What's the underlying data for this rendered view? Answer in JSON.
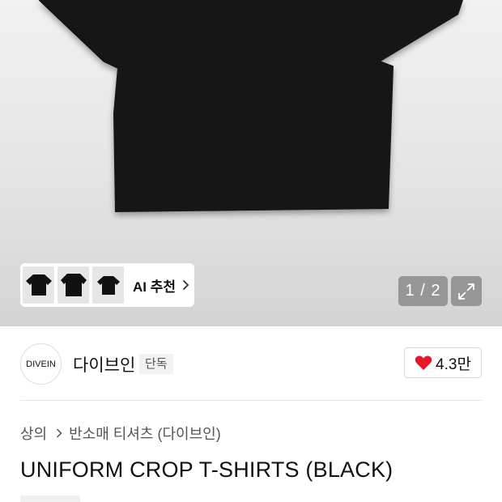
{
  "gallery": {
    "ai_recommend_label": "AI 추천",
    "page_indicator": "1 / 2",
    "thumbnail_count": 3
  },
  "brand": {
    "logo_text": "DIVEIN",
    "name": "다이브인",
    "badge": "단독",
    "like_count": "4.3만"
  },
  "breadcrumb": {
    "items": [
      "상의",
      "반소매 티셔츠 (다이브인)"
    ]
  },
  "product": {
    "title": "UNIFORM CROP T-SHIRTS (BLACK)"
  },
  "colors": {
    "heart": "#e4182b",
    "shirt": "#151515"
  },
  "icons": [
    "chevron-right-icon",
    "expand-icon",
    "heart-icon"
  ]
}
